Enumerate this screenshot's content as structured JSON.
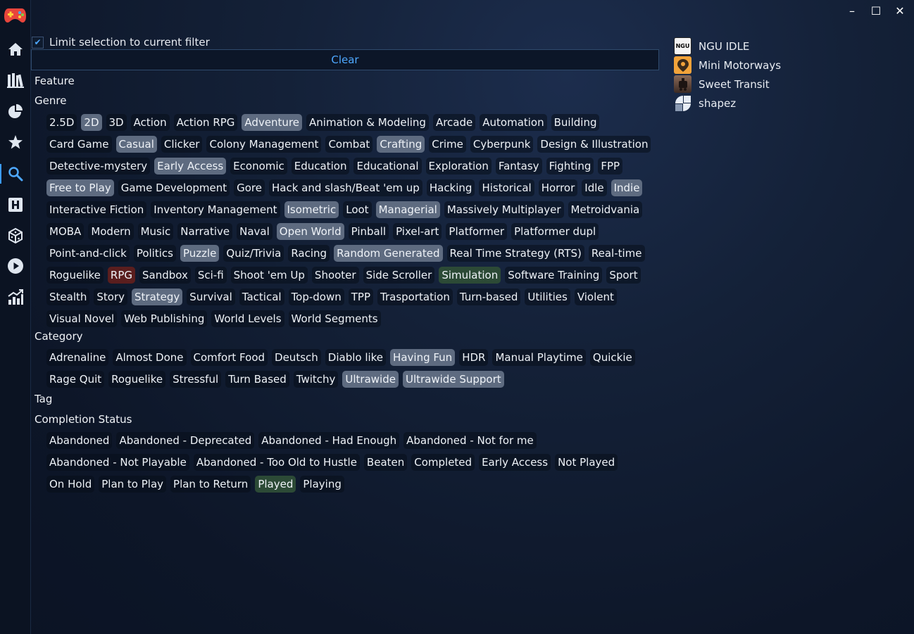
{
  "window": {
    "minimize": "–",
    "maximize": "☐",
    "close": "✕"
  },
  "filter": {
    "limit_label": "Limit selection to current filter",
    "limit_checked": true,
    "clear_label": "Clear"
  },
  "sections": {
    "feature": {
      "title": "Feature"
    },
    "genre": {
      "title": "Genre",
      "items": [
        {
          "label": "2.5D",
          "state": ""
        },
        {
          "label": "2D",
          "state": "sel"
        },
        {
          "label": "3D",
          "state": ""
        },
        {
          "label": "Action",
          "state": ""
        },
        {
          "label": "Action RPG",
          "state": ""
        },
        {
          "label": "Adventure",
          "state": "sel"
        },
        {
          "label": "Animation & Modeling",
          "state": ""
        },
        {
          "label": "Arcade",
          "state": ""
        },
        {
          "label": "Automation",
          "state": ""
        },
        {
          "label": "Building",
          "state": ""
        },
        {
          "label": "Card Game",
          "state": ""
        },
        {
          "label": "Casual",
          "state": "sel"
        },
        {
          "label": "Clicker",
          "state": ""
        },
        {
          "label": "Colony Management",
          "state": ""
        },
        {
          "label": "Combat",
          "state": ""
        },
        {
          "label": "Crafting",
          "state": "sel"
        },
        {
          "label": "Crime",
          "state": ""
        },
        {
          "label": "Cyberpunk",
          "state": ""
        },
        {
          "label": "Design & Illustration",
          "state": ""
        },
        {
          "label": "Detective-mystery",
          "state": ""
        },
        {
          "label": "Early Access",
          "state": "sel"
        },
        {
          "label": "Economic",
          "state": ""
        },
        {
          "label": "Education",
          "state": ""
        },
        {
          "label": "Educational",
          "state": ""
        },
        {
          "label": "Exploration",
          "state": ""
        },
        {
          "label": "Fantasy",
          "state": ""
        },
        {
          "label": "Fighting",
          "state": ""
        },
        {
          "label": "FPP",
          "state": ""
        },
        {
          "label": "Free to Play",
          "state": "sel"
        },
        {
          "label": "Game Development",
          "state": ""
        },
        {
          "label": "Gore",
          "state": ""
        },
        {
          "label": "Hack and slash/Beat 'em up",
          "state": ""
        },
        {
          "label": "Hacking",
          "state": ""
        },
        {
          "label": "Historical",
          "state": ""
        },
        {
          "label": "Horror",
          "state": ""
        },
        {
          "label": "Idle",
          "state": ""
        },
        {
          "label": "Indie",
          "state": "sel"
        },
        {
          "label": "Interactive Fiction",
          "state": ""
        },
        {
          "label": "Inventory Management",
          "state": ""
        },
        {
          "label": "Isometric",
          "state": "sel"
        },
        {
          "label": "Loot",
          "state": ""
        },
        {
          "label": "Managerial",
          "state": "sel"
        },
        {
          "label": "Massively Multiplayer",
          "state": ""
        },
        {
          "label": "Metroidvania",
          "state": ""
        },
        {
          "label": "MOBA",
          "state": ""
        },
        {
          "label": "Modern",
          "state": ""
        },
        {
          "label": "Music",
          "state": ""
        },
        {
          "label": "Narrative",
          "state": ""
        },
        {
          "label": "Naval",
          "state": ""
        },
        {
          "label": "Open World",
          "state": "sel"
        },
        {
          "label": "Pinball",
          "state": ""
        },
        {
          "label": "Pixel-art",
          "state": ""
        },
        {
          "label": "Platformer",
          "state": ""
        },
        {
          "label": "Platformer dupl",
          "state": ""
        },
        {
          "label": "Point-and-click",
          "state": ""
        },
        {
          "label": "Politics",
          "state": ""
        },
        {
          "label": "Puzzle",
          "state": "sel"
        },
        {
          "label": "Quiz/Trivia",
          "state": ""
        },
        {
          "label": "Racing",
          "state": ""
        },
        {
          "label": "Random Generated",
          "state": "sel"
        },
        {
          "label": "Real Time Strategy (RTS)",
          "state": ""
        },
        {
          "label": "Real-time",
          "state": ""
        },
        {
          "label": "Roguelike",
          "state": ""
        },
        {
          "label": "RPG",
          "state": "red"
        },
        {
          "label": "Sandbox",
          "state": ""
        },
        {
          "label": "Sci-fi",
          "state": ""
        },
        {
          "label": "Shoot 'em Up",
          "state": ""
        },
        {
          "label": "Shooter",
          "state": ""
        },
        {
          "label": "Side Scroller",
          "state": ""
        },
        {
          "label": "Simulation",
          "state": "green"
        },
        {
          "label": "Software Training",
          "state": ""
        },
        {
          "label": "Sport",
          "state": ""
        },
        {
          "label": "Stealth",
          "state": ""
        },
        {
          "label": "Story",
          "state": ""
        },
        {
          "label": "Strategy",
          "state": "sel"
        },
        {
          "label": "Survival",
          "state": ""
        },
        {
          "label": "Tactical",
          "state": ""
        },
        {
          "label": "Top-down",
          "state": ""
        },
        {
          "label": "TPP",
          "state": ""
        },
        {
          "label": "Trasportation",
          "state": ""
        },
        {
          "label": "Turn-based",
          "state": ""
        },
        {
          "label": "Utilities",
          "state": ""
        },
        {
          "label": "Violent",
          "state": ""
        },
        {
          "label": "Visual Novel",
          "state": ""
        },
        {
          "label": "Web Publishing",
          "state": ""
        },
        {
          "label": "World Levels",
          "state": ""
        },
        {
          "label": "World Segments",
          "state": ""
        }
      ]
    },
    "category": {
      "title": "Category",
      "items": [
        {
          "label": "Adrenaline",
          "state": ""
        },
        {
          "label": "Almost Done",
          "state": ""
        },
        {
          "label": "Comfort Food",
          "state": ""
        },
        {
          "label": "Deutsch",
          "state": ""
        },
        {
          "label": "Diablo like",
          "state": ""
        },
        {
          "label": "Having Fun",
          "state": "sel"
        },
        {
          "label": "HDR",
          "state": ""
        },
        {
          "label": "Manual Playtime",
          "state": ""
        },
        {
          "label": "Quickie",
          "state": ""
        },
        {
          "label": "Rage Quit",
          "state": ""
        },
        {
          "label": "Roguelike",
          "state": ""
        },
        {
          "label": "Stressful",
          "state": ""
        },
        {
          "label": "Turn Based",
          "state": ""
        },
        {
          "label": "Twitchy",
          "state": ""
        },
        {
          "label": "Ultrawide",
          "state": "sel"
        },
        {
          "label": "Ultrawide Support",
          "state": "sel"
        }
      ]
    },
    "tag": {
      "title": "Tag"
    },
    "completion": {
      "title": "Completion Status",
      "items": [
        {
          "label": "Abandoned",
          "state": ""
        },
        {
          "label": "Abandoned - Deprecated",
          "state": ""
        },
        {
          "label": "Abandoned - Had Enough",
          "state": ""
        },
        {
          "label": "Abandoned - Not for me",
          "state": ""
        },
        {
          "label": "Abandoned - Not Playable",
          "state": ""
        },
        {
          "label": "Abandoned - Too Old to Hustle",
          "state": ""
        },
        {
          "label": "Beaten",
          "state": ""
        },
        {
          "label": "Completed",
          "state": ""
        },
        {
          "label": "Early Access",
          "state": ""
        },
        {
          "label": "Not Played",
          "state": ""
        },
        {
          "label": "On Hold",
          "state": ""
        },
        {
          "label": "Plan to Play",
          "state": ""
        },
        {
          "label": "Plan to Return",
          "state": ""
        },
        {
          "label": "Played",
          "state": "green"
        },
        {
          "label": "Playing",
          "state": ""
        }
      ]
    }
  },
  "games": [
    {
      "name": "NGU IDLE",
      "icon": "ngu-idle-icon",
      "icon_text": "NGU",
      "color": "#f4f4f4"
    },
    {
      "name": "Mini Motorways",
      "icon": "mini-motorways-icon",
      "color": "#f2a33a"
    },
    {
      "name": "Sweet Transit",
      "icon": "sweet-transit-icon",
      "color": "#6b4a3a"
    },
    {
      "name": "shapez",
      "icon": "shapez-icon",
      "color": "#e8eef7"
    }
  ],
  "colors": {
    "accent": "#4ea8ff",
    "selected": "#5e6b80",
    "green": "#2c4a36",
    "red": "#5a1e1e"
  }
}
